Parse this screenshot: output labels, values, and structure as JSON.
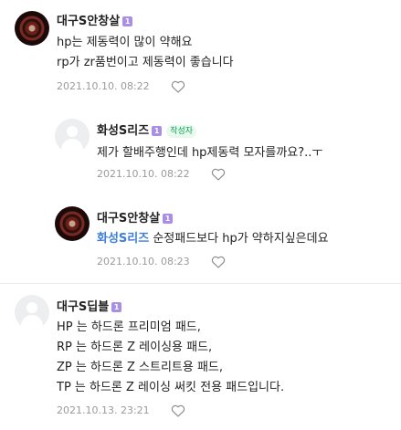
{
  "comments": [
    {
      "author": "대구S안창살",
      "level": "1",
      "lines": [
        "hp는 제동력이 많이 약해요",
        "rp가 zr품번이고 제동력이 좋습니다"
      ],
      "date": "2021.10.10. 08:22"
    },
    {
      "author": "화성S리즈",
      "level": "1",
      "badge": "작성자",
      "lines": [
        "제가 할배주행인데 hp제동력 모자를까요?..ㅜ"
      ],
      "date": "2021.10.10. 08:22"
    },
    {
      "author": "대구S안창살",
      "level": "1",
      "mention": "화성S리즈",
      "text": " 순정패드보다 hp가 약하지싶은데요",
      "date": "2021.10.10. 08:23"
    },
    {
      "author": "대구S딥블",
      "level": "1",
      "lines": [
        "HP 는 하드론 프리미엄 패드,",
        "RP 는 하드론 Z 레이싱용 패드,",
        "ZP 는 하드론 Z 스트리트용 패드,",
        "TP 는 하드론 Z 레이싱 써킷 전용 패드입니다."
      ],
      "date": "2021.10.13. 23:21"
    }
  ],
  "icons": {
    "like": "heart-outline-icon",
    "level": "level-badge-icon"
  },
  "colors": {
    "mention": "#3d7fd9",
    "writer_badge_text": "#03a94d",
    "level_badge": "#a98ee6",
    "date_text": "#9a9a9a"
  }
}
